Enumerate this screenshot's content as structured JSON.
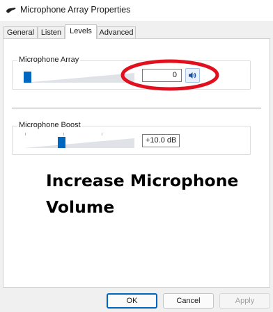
{
  "window": {
    "title": "Microphone Array Properties",
    "icon": "microphone-device-icon"
  },
  "tabs": [
    {
      "label": "General",
      "selected": false
    },
    {
      "label": "Listen",
      "selected": false
    },
    {
      "label": "Levels",
      "selected": true
    },
    {
      "label": "Advanced",
      "selected": false
    }
  ],
  "levels": {
    "microphone_array": {
      "label": "Microphone Array",
      "value": "0",
      "slider_level": 0,
      "speaker_icon": "speaker-volume-icon"
    },
    "microphone_boost": {
      "label": "Microphone Boost",
      "value": "+10.0 dB",
      "slider_level": 0.333
    }
  },
  "annotation": {
    "caption": "Increase Microphone Volume",
    "ring_color": "#e0101e"
  },
  "buttons": {
    "ok": "OK",
    "cancel": "Cancel",
    "apply": "Apply"
  },
  "colors": {
    "accent": "#0067c0",
    "disabled_text": "#a0a0a0"
  }
}
